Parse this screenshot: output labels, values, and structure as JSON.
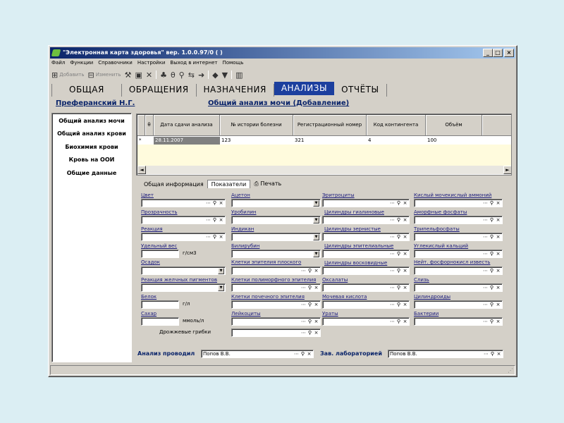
{
  "window": {
    "title": "\"Электронная карта здоровья\" вер. 1.0.0.97/0 ( )"
  },
  "menu": [
    "Файл",
    "Функции",
    "Справочники",
    "Настройки",
    "Выход в интернет",
    "Помощь"
  ],
  "toolbar": {
    "add_label": "Добавить",
    "edit_label": "Изменить"
  },
  "tabs": [
    "ОБЩАЯ",
    "ОБРАЩЕНИЯ",
    "НАЗНАЧЕНИЯ",
    "АНАЛИЗЫ",
    "ОТЧЁТЫ"
  ],
  "active_tab": "АНАЛИЗЫ",
  "patient_name": "Преферанский Н.Г.",
  "form_title": "Общий анализ мочи (Добавление)",
  "sidebar": [
    "Общий анализ мочи",
    "Общий анализ крови",
    "Биохимия крови",
    "Кровь на ООИ",
    "Общие данные"
  ],
  "grid": {
    "columns": [
      "Дата сдачи анализа",
      "№ истории болезни",
      "Регистрационный номер",
      "Код контингента",
      "Объём"
    ],
    "attach_icon": "θ",
    "row": {
      "marker": "*",
      "date": "28.11.2007",
      "history": "123",
      "reg": "321",
      "code": "4",
      "volume": "100"
    }
  },
  "subtabs": {
    "general": "Общая информация",
    "indicators": "Показатели",
    "print": "Печать"
  },
  "fields": {
    "color": "Цвет",
    "transparency": "Прозрачность",
    "reaction": "Реакция",
    "gravity": "Удельный вес",
    "gravity_unit": "г/см3",
    "sediment": "Осадок",
    "bile": "Реакция желчных пигментов",
    "protein": "Белок",
    "protein_unit": "г/л",
    "sugar": "Сахар",
    "sugar_unit": "ммоль/л",
    "yeast": "Дрожжевые грибки",
    "acetone": "Ацетон",
    "urobilin": "Уробилин",
    "indican": "Индикан",
    "bilirubin": "Билирубин",
    "flat_epi": "Клетки эпителия плоского",
    "poly_epi": "Клетки полиморфного эпителия",
    "renal_epi": "Клетки почечного эпителия",
    "leukocytes": "Лейкоциты",
    "erythrocytes": "Эритроциты",
    "hyaline": "Цилиндры гиалиновые",
    "granular": "Цилиндры зернистые",
    "epithelial_cyl": "Цилиндры эпителиальные",
    "waxy": "Цилиндры восковидные",
    "oxalates": "Оксалаты",
    "uric_acid": "Мочевая кислота",
    "urates": "Ураты",
    "uric_ammonium": "Кислый мочекислый аммоний",
    "amorph_phos": "Аморфные фосфаты",
    "triple_phos": "Трипельфосфаты",
    "calcium_carb": "Углекислый кальций",
    "neutral_phos": "Нейт. фосфорнокисл известь",
    "mucus": "Слизь",
    "cylindroids": "Цилиндроиды",
    "bacteria": "Бактерии"
  },
  "bottom": {
    "conducted_label": "Анализ проводил",
    "conducted_value": "Попов В.В.",
    "head_label": "Зав. лабораторией",
    "head_value": "Попов В.В."
  }
}
